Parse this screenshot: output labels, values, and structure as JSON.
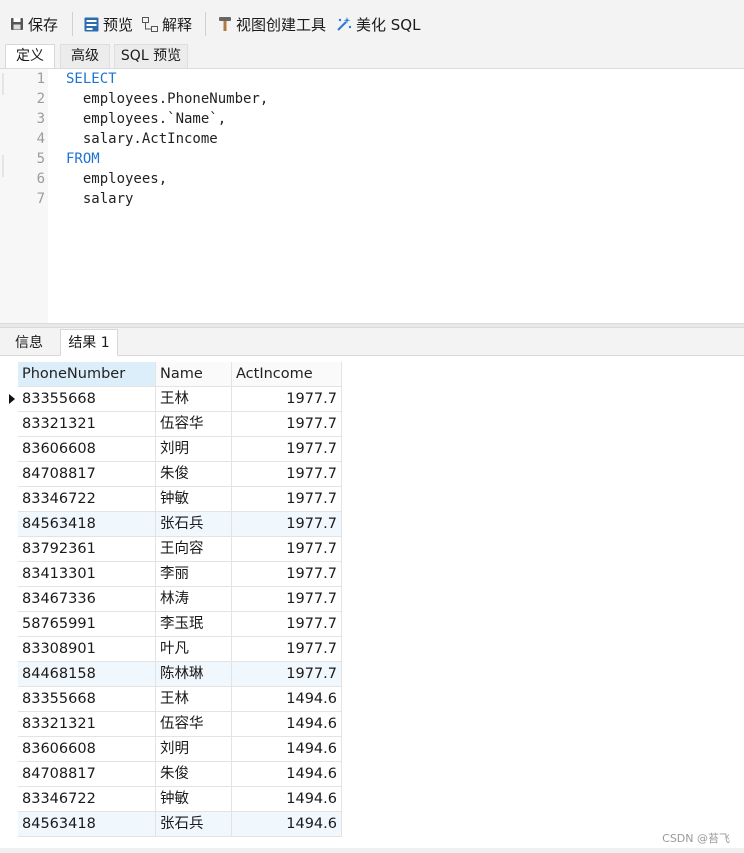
{
  "toolbar": {
    "save": "保存",
    "preview": "预览",
    "explain": "解释",
    "view_builder": "视图创建工具",
    "beautify": "美化 SQL"
  },
  "editor_tabs": [
    "定义",
    "高级",
    "SQL 预览"
  ],
  "code_lines": [
    {
      "n": "1",
      "kw": "SELECT",
      "text": ""
    },
    {
      "n": "2",
      "kw": "",
      "text": "  employees.PhoneNumber,"
    },
    {
      "n": "3",
      "kw": "",
      "text": "  employees.`Name`,"
    },
    {
      "n": "4",
      "kw": "",
      "text": "  salary.ActIncome"
    },
    {
      "n": "5",
      "kw": "FROM",
      "text": ""
    },
    {
      "n": "6",
      "kw": "",
      "text": "  employees,"
    },
    {
      "n": "7",
      "kw": "",
      "text": "  salary"
    }
  ],
  "result_tabs": [
    "信息",
    "结果 1"
  ],
  "columns": [
    "PhoneNumber",
    "Name",
    "ActIncome"
  ],
  "rows": [
    [
      "83355668",
      "王林",
      "1977.7"
    ],
    [
      "83321321",
      "伍容华",
      "1977.7"
    ],
    [
      "83606608",
      "刘明",
      "1977.7"
    ],
    [
      "84708817",
      "朱俊",
      "1977.7"
    ],
    [
      "83346722",
      "钟敏",
      "1977.7"
    ],
    [
      "84563418",
      "张石兵",
      "1977.7"
    ],
    [
      "83792361",
      "王向容",
      "1977.7"
    ],
    [
      "83413301",
      "李丽",
      "1977.7"
    ],
    [
      "83467336",
      "林涛",
      "1977.7"
    ],
    [
      "58765991",
      "李玉珉",
      "1977.7"
    ],
    [
      "83308901",
      "叶凡",
      "1977.7"
    ],
    [
      "84468158",
      "陈林琳",
      "1977.7"
    ],
    [
      "83355668",
      "王林",
      "1494.6"
    ],
    [
      "83321321",
      "伍容华",
      "1494.6"
    ],
    [
      "83606608",
      "刘明",
      "1494.6"
    ],
    [
      "84708817",
      "朱俊",
      "1494.6"
    ],
    [
      "83346722",
      "钟敏",
      "1494.6"
    ],
    [
      "84563418",
      "张石兵",
      "1494.6"
    ]
  ],
  "watermark": "CSDN @苔飞",
  "colors": {
    "keyword": "#1e73d6",
    "selected_header": "#dbeefa",
    "alt_row": "#f0f7fd"
  }
}
